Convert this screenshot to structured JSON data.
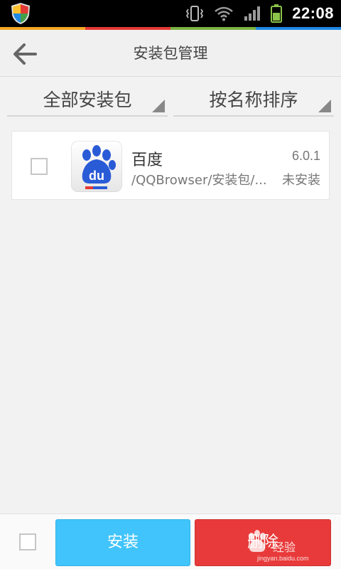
{
  "status_bar": {
    "time": "22:08",
    "stripe_colors": [
      "#f5a623",
      "#e53935",
      "#7cb342",
      "#1e88e5"
    ],
    "icons": [
      "shield-icon",
      "vibrate-icon",
      "wifi-icon",
      "signal-icon",
      "battery-icon"
    ]
  },
  "header": {
    "title": "安装包管理",
    "back_icon": "arrow-left-icon"
  },
  "filters": {
    "category": "全部安装包",
    "sort": "按名称排序"
  },
  "packages": [
    {
      "name": "百度",
      "version": "6.0.1",
      "path": "/QQBrowser/安装包/...",
      "status": "未安装",
      "checked": false,
      "icon": "baidu-paw-icon"
    }
  ],
  "bottom_bar": {
    "install_label": "安装",
    "delete_label": "删除",
    "install_color": "#40c4fb",
    "delete_color": "#e83a3a"
  },
  "watermark": {
    "text": "经验",
    "site": "jingyan.baidu.com"
  }
}
